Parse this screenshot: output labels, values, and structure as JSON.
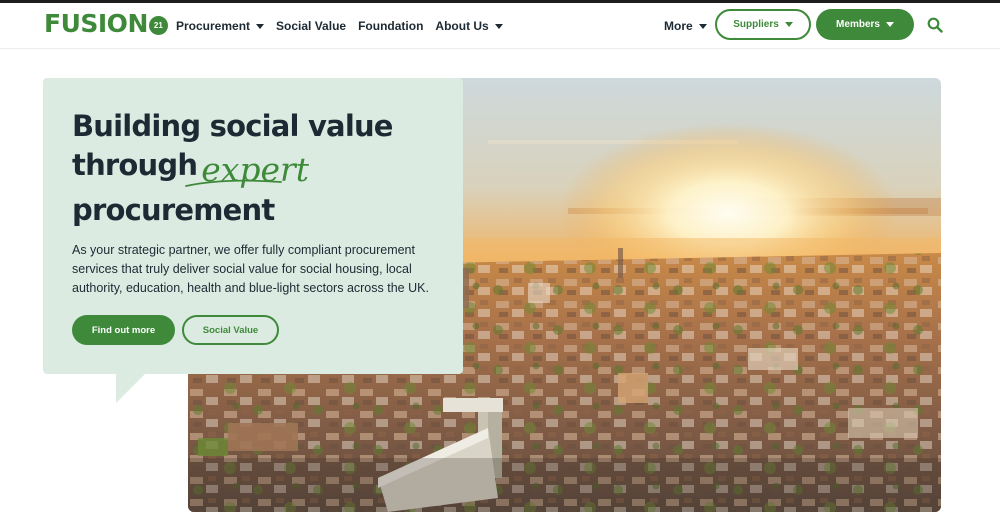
{
  "header": {
    "logo_text": "FUSION",
    "logo_badge": "21",
    "nav": [
      {
        "label": "Procurement",
        "dropdown": true
      },
      {
        "label": "Social Value",
        "dropdown": false
      },
      {
        "label": "Foundation",
        "dropdown": false
      },
      {
        "label": "About Us",
        "dropdown": true
      }
    ],
    "more_label": "More",
    "suppliers_label": "Suppliers",
    "members_label": "Members",
    "search_icon": "search-icon"
  },
  "hero": {
    "title_line1": "Building social value",
    "title_line2_prefix": "through",
    "title_line2_accent": "expert",
    "title_line3": "procurement",
    "description": "As your strategic partner, we offer fully compliant procurement services that truly deliver social value for social housing, local authority, education, health and blue-light sectors across the UK.",
    "cta_primary": "Find out more",
    "cta_secondary": "Social Value",
    "image": "aerial-city-sunset-image"
  },
  "colors": {
    "brand_green": "#3e8a3a",
    "card_bg": "#dcebe2",
    "text_dark": "#1d2a33"
  }
}
